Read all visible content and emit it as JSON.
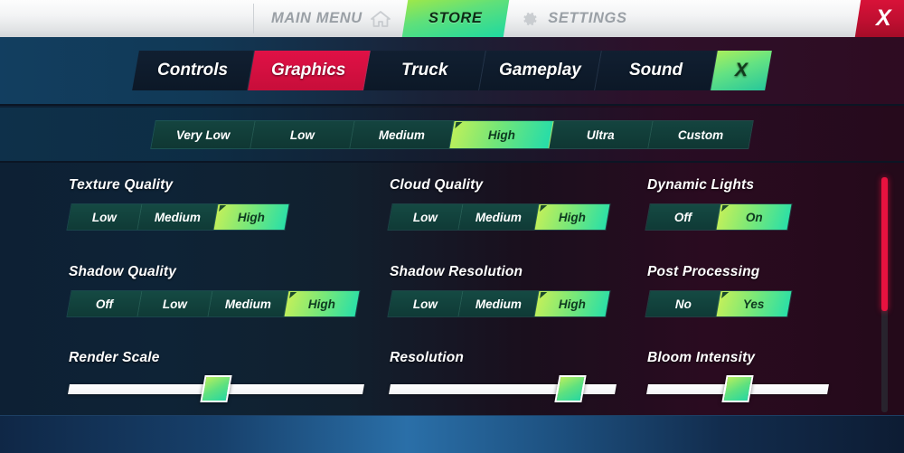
{
  "topbar": {
    "tabs": [
      {
        "label": "MAIN MENU",
        "icon": "home-icon",
        "active": false
      },
      {
        "label": "STORE",
        "icon": "",
        "active": true
      },
      {
        "label": "SETTINGS",
        "icon": "gear-icon",
        "active": false
      }
    ],
    "close_label": "X"
  },
  "category_tabs": [
    {
      "label": "Controls",
      "active": false
    },
    {
      "label": "Graphics",
      "active": true
    },
    {
      "label": "Truck",
      "active": false
    },
    {
      "label": "Gameplay",
      "active": false
    },
    {
      "label": "Sound",
      "active": false
    }
  ],
  "category_close_label": "X",
  "presets": {
    "options": [
      "Very Low",
      "Low",
      "Medium",
      "High",
      "Ultra",
      "Custom"
    ],
    "selected": "High"
  },
  "settings": [
    {
      "label": "Texture Quality",
      "type": "options",
      "options": [
        "Low",
        "Medium",
        "High"
      ],
      "selected": "High"
    },
    {
      "label": "Cloud Quality",
      "type": "options",
      "options": [
        "Low",
        "Medium",
        "High"
      ],
      "selected": "High"
    },
    {
      "label": "Dynamic Lights",
      "type": "options",
      "options": [
        "Off",
        "On"
      ],
      "selected": "On"
    },
    {
      "label": "Shadow Quality",
      "type": "options",
      "options": [
        "Off",
        "Low",
        "Medium",
        "High"
      ],
      "selected": "High"
    },
    {
      "label": "Shadow Resolution",
      "type": "options",
      "options": [
        "Low",
        "Medium",
        "High"
      ],
      "selected": "High"
    },
    {
      "label": "Post Processing",
      "type": "options",
      "options": [
        "No",
        "Yes"
      ],
      "selected": "Yes"
    },
    {
      "label": "Render Scale",
      "type": "slider",
      "value_percent": 50,
      "track_width": 326
    },
    {
      "label": "Resolution",
      "type": "slider",
      "value_percent": 80,
      "track_width": 250
    },
    {
      "label": "Bloom Intensity",
      "type": "slider",
      "value_percent": 50,
      "track_width": 200
    }
  ],
  "scrollbar": {
    "thumb_percent": 57,
    "color": "#e8123f"
  },
  "colors": {
    "accent_green": "#28dfa8",
    "accent_lime": "#c5f059",
    "active_tab_red": "#e01146",
    "close_red": "#c00f31"
  }
}
